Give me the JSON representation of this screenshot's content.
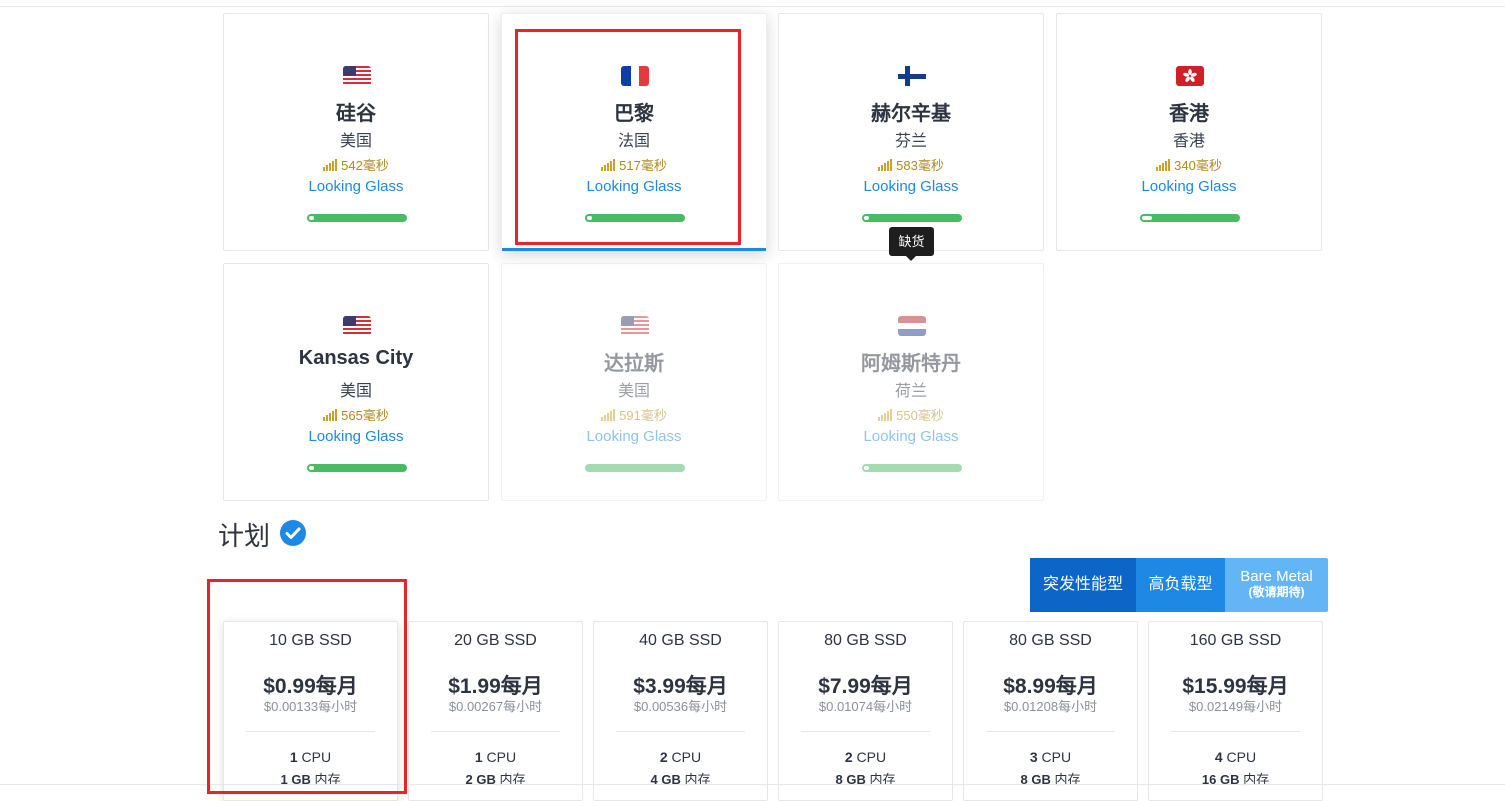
{
  "locations": [
    {
      "name": "硅谷",
      "country": "美国",
      "latency": "542毫秒",
      "looking_glass": "Looking Glass",
      "flag": "us-flag",
      "state": "available"
    },
    {
      "name": "巴黎",
      "country": "法国",
      "latency": "517毫秒",
      "looking_glass": "Looking Glass",
      "flag": "fr-flag",
      "state": "selected"
    },
    {
      "name": "赫尔辛基",
      "country": "芬兰",
      "latency": "583毫秒",
      "looking_glass": "Looking Glass",
      "flag": "fi-flag",
      "state": "available"
    },
    {
      "name": "香港",
      "country": "香港",
      "latency": "340毫秒",
      "looking_glass": "Looking Glass",
      "flag": "hk-flag",
      "state": "available"
    },
    {
      "name": "Kansas City",
      "country": "美国",
      "latency": "565毫秒",
      "looking_glass": "Looking Glass",
      "flag": "us-flag",
      "state": "available"
    },
    {
      "name": "达拉斯",
      "country": "美国",
      "latency": "591毫秒",
      "looking_glass": "Looking Glass",
      "flag": "us-flag",
      "state": "unavailable"
    },
    {
      "name": "阿姆斯特丹",
      "country": "荷兰",
      "latency": "550毫秒",
      "looking_glass": "Looking Glass",
      "flag": "nl-flag",
      "state": "unavailable"
    }
  ],
  "tooltip": {
    "text": "缺货"
  },
  "plans": {
    "heading": "计划",
    "tabs": [
      {
        "label": "突发性能型",
        "active": true
      },
      {
        "label": "高负载型",
        "active": false
      },
      {
        "label": "Bare Metal",
        "sublabel": "(敬请期待)",
        "active": false
      }
    ],
    "cards": [
      {
        "storage": "10 GB SSD",
        "price": "$0.99每月",
        "hourly": "$0.00133每小时",
        "cpu_count": "1",
        "cpu_unit": " CPU",
        "ram_amount": "1 GB",
        "ram_unit": " 内存"
      },
      {
        "storage": "20 GB SSD",
        "price": "$1.99每月",
        "hourly": "$0.00267每小时",
        "cpu_count": "1",
        "cpu_unit": " CPU",
        "ram_amount": "2 GB",
        "ram_unit": " 内存"
      },
      {
        "storage": "40 GB SSD",
        "price": "$3.99每月",
        "hourly": "$0.00536每小时",
        "cpu_count": "2",
        "cpu_unit": " CPU",
        "ram_amount": "4 GB",
        "ram_unit": " 内存"
      },
      {
        "storage": "80 GB SSD",
        "price": "$7.99每月",
        "hourly": "$0.01074每小时",
        "cpu_count": "2",
        "cpu_unit": " CPU",
        "ram_amount": "8 GB",
        "ram_unit": " 内存"
      },
      {
        "storage": "80 GB SSD",
        "price": "$8.99每月",
        "hourly": "$0.01208每小时",
        "cpu_count": "3",
        "cpu_unit": " CPU",
        "ram_amount": "8 GB",
        "ram_unit": " 内存"
      },
      {
        "storage": "160 GB SSD",
        "price": "$15.99每月",
        "hourly": "$0.02149每小时",
        "cpu_count": "4",
        "cpu_unit": " CPU",
        "ram_amount": "16 GB",
        "ram_unit": " 内存"
      }
    ]
  },
  "colors": {
    "accent": "#1e88e5",
    "selection_box": "#e8232a",
    "latency_text": "#b08a1e",
    "status_bar": "#48bb63",
    "tab_active": "#0b66c7",
    "tab_secondary": "#1e88e5",
    "tab_soon": "#64b5f6"
  }
}
